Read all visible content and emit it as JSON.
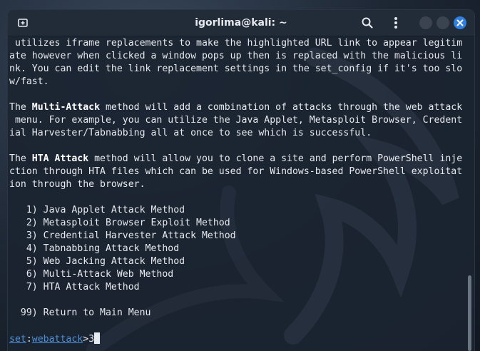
{
  "window": {
    "title": "igorlima@kali: ~"
  },
  "terminal": {
    "lines": [
      [
        {
          "t": " utilizes iframe replacements to make the highlighted URL link to appear legitim"
        }
      ],
      [
        {
          "t": "ate however when clicked a window pops up then is replaced with the malicious li"
        }
      ],
      [
        {
          "t": "nk. You can edit the link replacement settings in the set_config if it's too slo"
        }
      ],
      [
        {
          "t": "w/fast."
        }
      ],
      [],
      [
        {
          "t": "The "
        },
        {
          "t": "Multi-Attack",
          "b": true
        },
        {
          "t": " method will add a combination of attacks through the web attack"
        }
      ],
      [
        {
          "t": " menu. For example, you can utilize the Java Applet, Metasploit Browser, Credent"
        }
      ],
      [
        {
          "t": "ial Harvester/Tabnabbing all at once to see which is successful."
        }
      ],
      [],
      [
        {
          "t": "The "
        },
        {
          "t": "HTA Attack",
          "b": true
        },
        {
          "t": " method will allow you to clone a site and perform PowerShell inje"
        }
      ],
      [
        {
          "t": "ction through HTA files which can be used for Windows-based PowerShell exploitat"
        }
      ],
      [
        {
          "t": "ion through the browser."
        }
      ],
      [],
      [
        {
          "t": "   1) Java Applet Attack Method"
        }
      ],
      [
        {
          "t": "   2) Metasploit Browser Exploit Method"
        }
      ],
      [
        {
          "t": "   3) Credential Harvester Attack Method"
        }
      ],
      [
        {
          "t": "   4) Tabnabbing Attack Method"
        }
      ],
      [
        {
          "t": "   5) Web Jacking Attack Method"
        }
      ],
      [
        {
          "t": "   6) Multi-Attack Web Method"
        }
      ],
      [
        {
          "t": "   7) HTA Attack Method"
        }
      ],
      [],
      [
        {
          "t": "  99) Return to Main Menu"
        }
      ],
      []
    ],
    "prompt": {
      "set": "set",
      "colon": ":",
      "module": "webattack",
      "gt": ">",
      "input": "3"
    }
  },
  "colors": {
    "background": "#1b2330",
    "titlebar": "#222b38",
    "text": "#e7eaee",
    "prompt_accent": "#4d8fd6",
    "close_button": "#2f7fe0"
  },
  "icons": {
    "new_tab": "new-tab-icon",
    "search": "search-icon",
    "menu": "kebab-menu-icon",
    "close": "close-icon"
  }
}
